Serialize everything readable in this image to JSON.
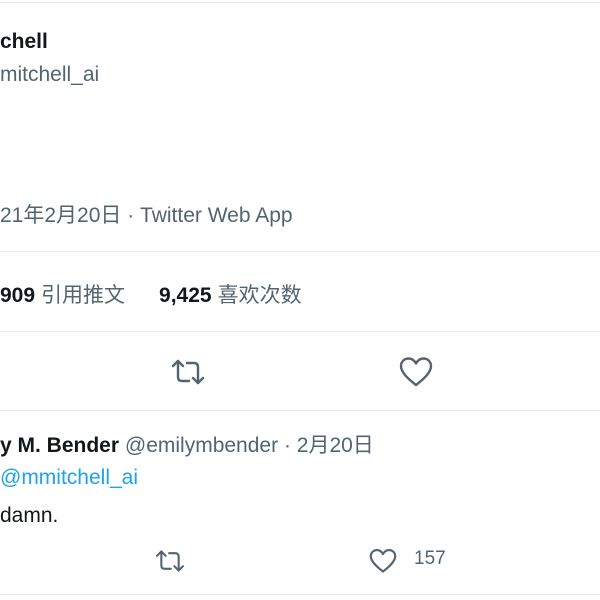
{
  "tweet": {
    "author_name": "chell",
    "author_handle": "mitchell_ai",
    "timestamp": "21年2月20日 · Twitter Web App",
    "stats": {
      "quote_count": "909",
      "quote_label": "引用推文",
      "like_count": "9,425",
      "like_label": "喜欢次数"
    },
    "actions": {
      "retweet_icon": "retweet-icon",
      "like_icon": "heart-icon"
    }
  },
  "reply": {
    "author_name": "y M. Bender",
    "author_handle": "@emilymbender",
    "date": "· 2月20日",
    "replying_to": "@mmitchell_ai",
    "text": "damn.",
    "like_count": "157"
  },
  "colors": {
    "text": "#14171a",
    "secondary": "#536471",
    "link": "#1da1f2",
    "divider": "#e6ecf0"
  }
}
